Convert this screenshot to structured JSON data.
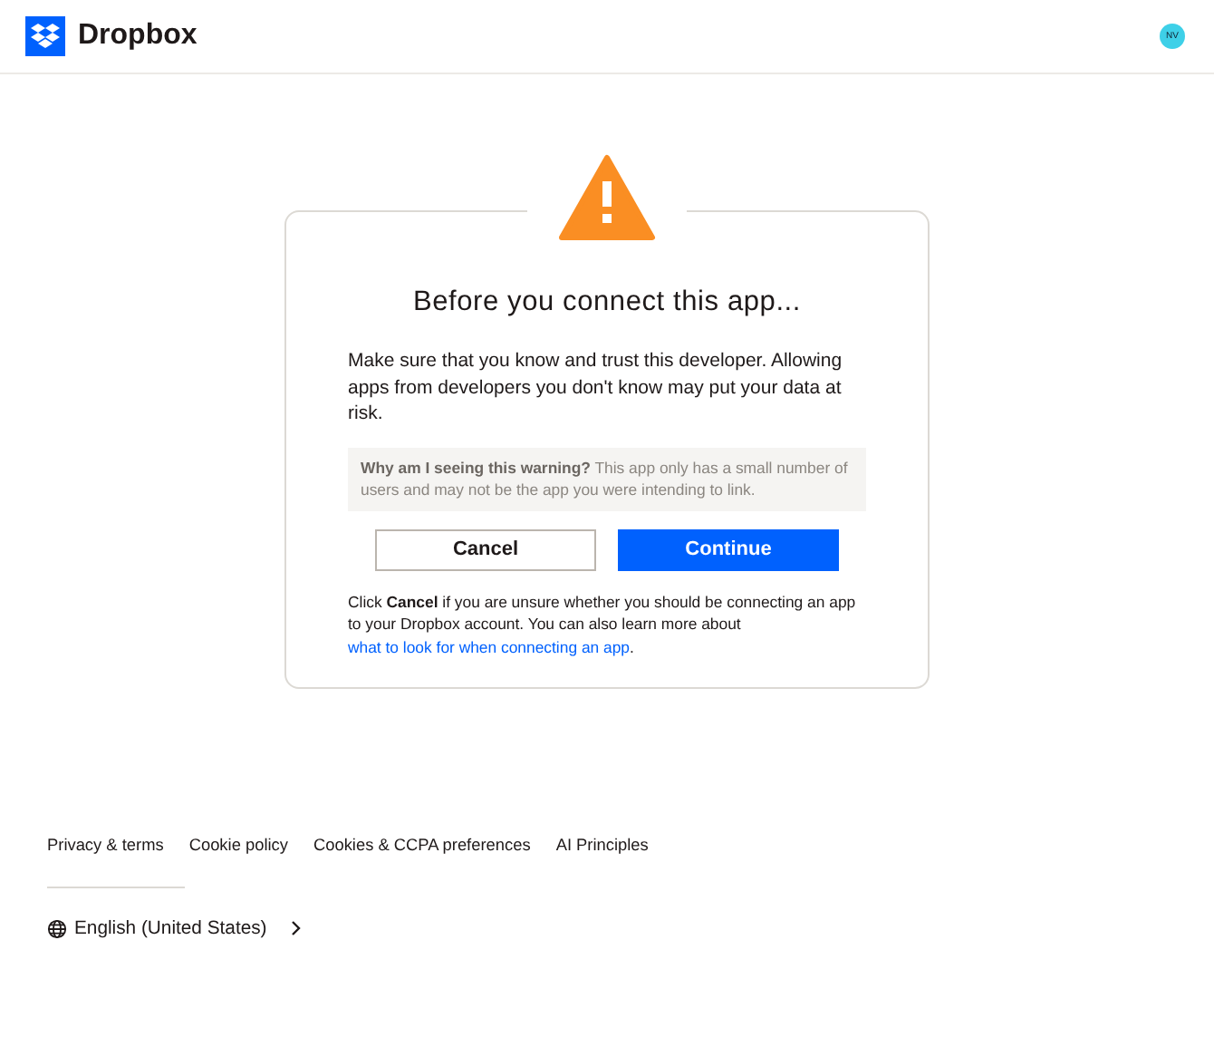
{
  "header": {
    "brand": "Dropbox",
    "avatar": "NV"
  },
  "dialog": {
    "title": "Before you connect this app...",
    "intro": "Make sure that you know and trust this developer. Allowing apps from developers you don't know may put your data at risk.",
    "warning": "**Why am I seeing this warning?** This app only has a small number of users and may not be the app you were intending to link.",
    "buttons": [
      {
        "label": "Cancel",
        "kind": "secondary"
      },
      {
        "label": "Continue",
        "kind": "primary"
      }
    ],
    "note": {
      "before": "Click **Cancel** if you are unsure whether you should be connecting an app to your Dropbox account. You can also learn more about ",
      "link": "what to look for when connecting an app",
      "after": "."
    }
  },
  "footer": {
    "links": [
      "Privacy & terms",
      "Cookie policy",
      "Cookies & CCPA preferences",
      "AI Principles"
    ],
    "language": "English (United States)"
  }
}
